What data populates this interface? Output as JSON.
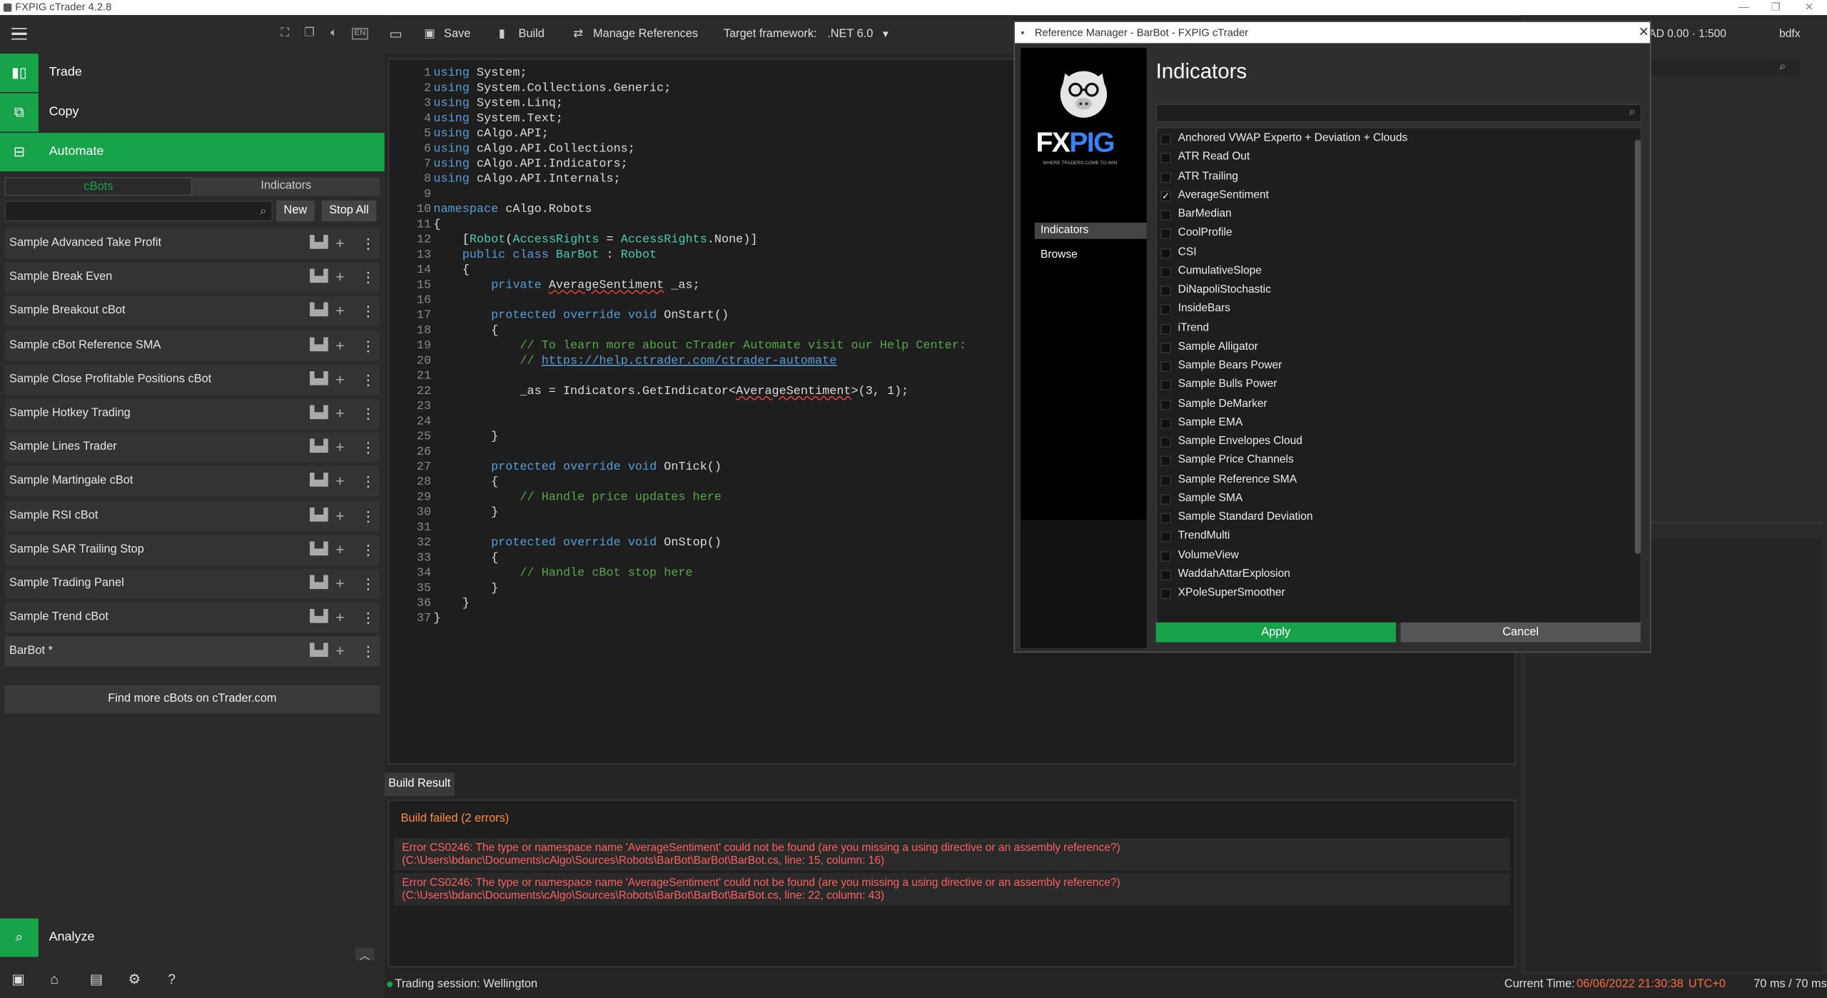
{
  "window": {
    "title": "FXPIG cTrader 4.2.8",
    "minimize": "—",
    "maximize": "❐",
    "close": "✕"
  },
  "left": {
    "nav": [
      {
        "label": "Trade"
      },
      {
        "label": "Copy"
      },
      {
        "label": "Automate"
      }
    ],
    "tabs": [
      "cBots",
      "Indicators"
    ],
    "new_label": "New",
    "stop_all_label": "Stop All",
    "bots": [
      "Sample Advanced Take Profit",
      "Sample Break Even",
      "Sample Breakout cBot",
      "Sample cBot Reference SMA",
      "Sample Close Profitable Positions cBot",
      "Sample Hotkey Trading",
      "Sample Lines Trader",
      "Sample Martingale cBot",
      "Sample RSI cBot",
      "Sample SAR Trailing Stop",
      "Sample Trading Panel",
      "Sample Trend cBot",
      "BarBot *"
    ],
    "find_more": "Find more cBots on cTrader.com",
    "analyze": "Analyze"
  },
  "toolbar": {
    "save": "Save",
    "build": "Build",
    "manage_refs": "Manage References",
    "target_label": "Target framework:",
    "target_value": ".NET 6.0"
  },
  "code": {
    "lines": [
      "using System;",
      "using System.Collections.Generic;",
      "using System.Linq;",
      "using System.Text;",
      "using cAlgo.API;",
      "using cAlgo.API.Collections;",
      "using cAlgo.API.Indicators;",
      "using cAlgo.API.Internals;",
      "",
      "namespace cAlgo.Robots",
      "{",
      "    [Robot(AccessRights = AccessRights.None)]",
      "    public class BarBot : Robot",
      "    {",
      "        private AverageSentiment _as;",
      "",
      "        protected override void OnStart()",
      "        {",
      "            // To learn more about cTrader Automate visit our Help Center:",
      "            // https://help.ctrader.com/ctrader-automate",
      "",
      "            _as = Indicators.GetIndicator<AverageSentiment>(3, 1);",
      "",
      "",
      "        }",
      "",
      "        protected override void OnTick()",
      "        {",
      "            // Handle price updates here",
      "        }",
      "",
      "        protected override void OnStop()",
      "        {",
      "            // Handle cBot stop here",
      "        }",
      "    }",
      "}"
    ]
  },
  "build": {
    "tab": "Build Result",
    "header": "Build failed (2 errors)",
    "errors": [
      "Error CS0246: The type or namespace name 'AverageSentiment' could not be found (are you missing a using directive or an assembly reference?) (C:\\Users\\bdanc\\Documents\\cAlgo\\Sources\\Robots\\BarBot\\BarBot\\BarBot.cs, line: 15, column: 16)",
      "Error CS0246: The type or namespace name 'AverageSentiment' could not be found (are you missing a using directive or an assembly reference?) (C:\\Users\\bdanc\\Documents\\cAlgo\\Sources\\Robots\\BarBot\\BarBot\\BarBot.cs, line: 22, column: 43)"
    ]
  },
  "right": {
    "info": "AD 0.00 · 1:500",
    "user": "bdfx"
  },
  "status": {
    "session": "Trading session: Wellington",
    "time_label": "Current Time:",
    "time_value": "06/06/2022 21:30:38",
    "tz": "UTC+0",
    "latency": "70 ms / 70 ms"
  },
  "dialog": {
    "title": "Reference Manager - BarBot - FXPIG cTrader",
    "brand": "FX",
    "brand2": "PIG",
    "tagline": "WHERE TRADERS COME TO WIN",
    "side": [
      "Indicators",
      "Browse"
    ],
    "heading": "Indicators",
    "items": [
      {
        "name": "Anchored VWAP Experto + Deviation + Clouds",
        "checked": false
      },
      {
        "name": "ATR Read Out",
        "checked": false
      },
      {
        "name": "ATR Trailing",
        "checked": false
      },
      {
        "name": "AverageSentiment",
        "checked": true
      },
      {
        "name": "BarMedian",
        "checked": false
      },
      {
        "name": "CoolProfile",
        "checked": false
      },
      {
        "name": "CSI",
        "checked": false
      },
      {
        "name": "CumulativeSlope",
        "checked": false
      },
      {
        "name": "DiNapoliStochastic",
        "checked": false
      },
      {
        "name": "InsideBars",
        "checked": false
      },
      {
        "name": "iTrend",
        "checked": false
      },
      {
        "name": "Sample Alligator",
        "checked": false
      },
      {
        "name": "Sample Bears Power",
        "checked": false
      },
      {
        "name": "Sample Bulls Power",
        "checked": false
      },
      {
        "name": "Sample DeMarker",
        "checked": false
      },
      {
        "name": "Sample EMA",
        "checked": false
      },
      {
        "name": "Sample Envelopes Cloud",
        "checked": false
      },
      {
        "name": "Sample Price Channels",
        "checked": false
      },
      {
        "name": "Sample Reference SMA",
        "checked": false
      },
      {
        "name": "Sample SMA",
        "checked": false
      },
      {
        "name": "Sample Standard Deviation",
        "checked": false
      },
      {
        "name": "TrendMulti",
        "checked": false
      },
      {
        "name": "VolumeView",
        "checked": false
      },
      {
        "name": "WaddahAttarExplosion",
        "checked": false
      },
      {
        "name": "XPoleSuperSmoother",
        "checked": false
      }
    ],
    "apply": "Apply",
    "cancel": "Cancel",
    "close": "✕"
  }
}
